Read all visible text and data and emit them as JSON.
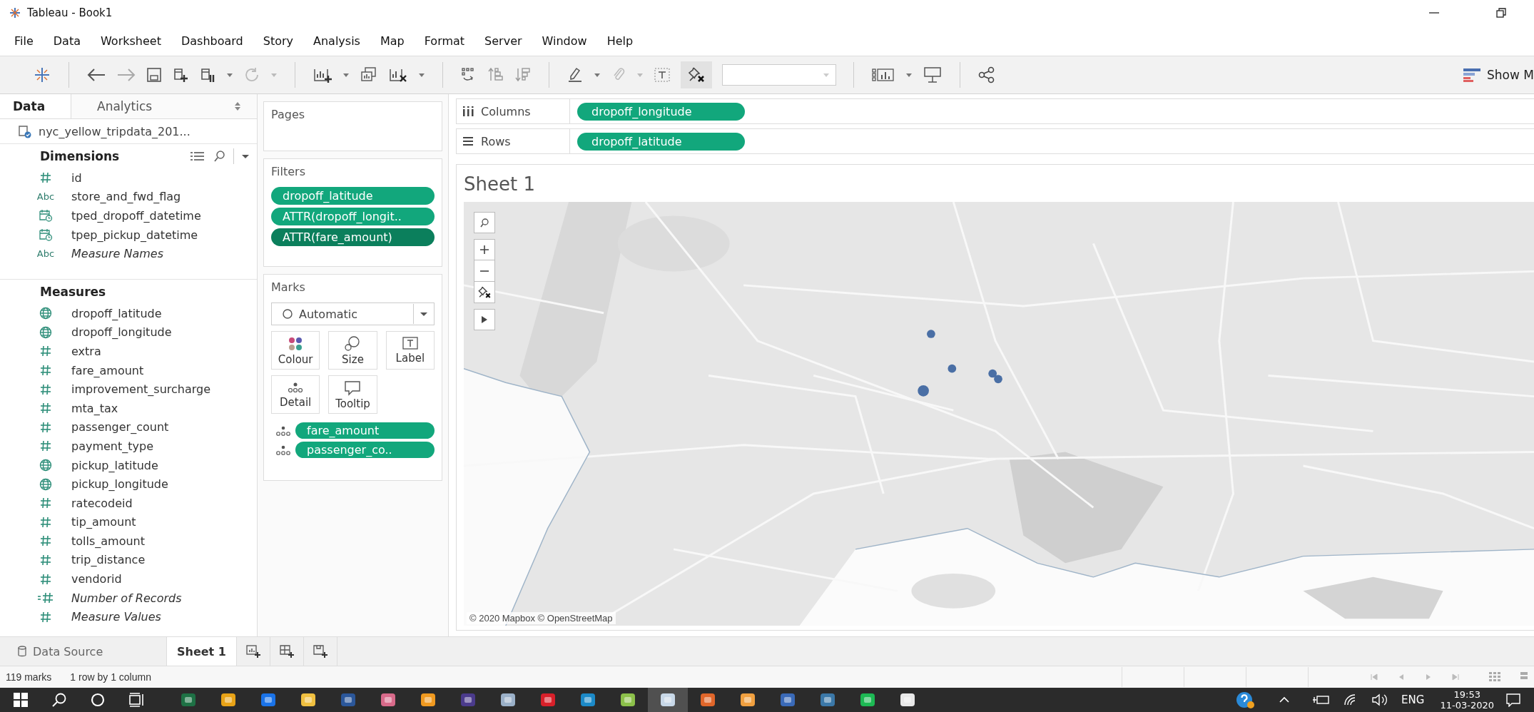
{
  "window": {
    "title": "Tableau - Book1"
  },
  "menu": [
    "File",
    "Data",
    "Worksheet",
    "Dashboard",
    "Story",
    "Analysis",
    "Map",
    "Format",
    "Server",
    "Window",
    "Help"
  ],
  "toolbar": {
    "show_me": "Show M"
  },
  "data_pane": {
    "tabs": [
      {
        "label": "Data",
        "selected": true
      },
      {
        "label": "Analytics",
        "selected": false
      }
    ],
    "data_source": "nyc_yellow_tripdata_201...",
    "dimensions": {
      "title": "Dimensions",
      "items": [
        {
          "kind": "number",
          "name": "id",
          "italic": false
        },
        {
          "kind": "string",
          "badge": "Abc",
          "name": "store_and_fwd_flag",
          "italic": false
        },
        {
          "kind": "date",
          "name": "tped_dropoff_datetime",
          "italic": false
        },
        {
          "kind": "date",
          "name": "tpep_pickup_datetime",
          "italic": false
        },
        {
          "kind": "string",
          "badge": "Abc",
          "name": "Measure Names",
          "italic": true
        }
      ]
    },
    "measures": {
      "title": "Measures",
      "items": [
        {
          "kind": "geo",
          "name": "dropoff_latitude",
          "italic": false
        },
        {
          "kind": "geo",
          "name": "dropoff_longitude",
          "italic": false
        },
        {
          "kind": "number",
          "name": "extra",
          "italic": false
        },
        {
          "kind": "number",
          "name": "fare_amount",
          "italic": false
        },
        {
          "kind": "number",
          "name": "improvement_surcharge",
          "italic": false
        },
        {
          "kind": "number",
          "name": "mta_tax",
          "italic": false
        },
        {
          "kind": "number",
          "name": "passenger_count",
          "italic": false
        },
        {
          "kind": "number",
          "name": "payment_type",
          "italic": false
        },
        {
          "kind": "geo",
          "name": "pickup_latitude",
          "italic": false
        },
        {
          "kind": "geo",
          "name": "pickup_longitude",
          "italic": false
        },
        {
          "kind": "number",
          "name": "ratecodeid",
          "italic": false
        },
        {
          "kind": "number",
          "name": "tip_amount",
          "italic": false
        },
        {
          "kind": "number",
          "name": "tolls_amount",
          "italic": false
        },
        {
          "kind": "number",
          "name": "trip_distance",
          "italic": false
        },
        {
          "kind": "number",
          "name": "vendorid",
          "italic": false
        },
        {
          "kind": "calc",
          "name": "Number of Records",
          "italic": true
        },
        {
          "kind": "number",
          "name": "Measure Values",
          "italic": true
        }
      ]
    }
  },
  "pages": {
    "title": "Pages"
  },
  "filters": {
    "title": "Filters",
    "pills": [
      {
        "label": "dropoff_latitude",
        "selected": false
      },
      {
        "label": "ATTR(dropoff_longit..",
        "selected": false
      },
      {
        "label": "ATTR(fare_amount)",
        "selected": true
      }
    ]
  },
  "marks": {
    "title": "Marks",
    "mark_type": "Automatic",
    "cards": [
      {
        "kind": "colour",
        "label": "Colour"
      },
      {
        "kind": "size",
        "label": "Size"
      },
      {
        "kind": "label",
        "label": "Label"
      },
      {
        "kind": "detail",
        "label": "Detail"
      },
      {
        "kind": "tooltip",
        "label": "Tooltip"
      }
    ],
    "pills": [
      {
        "label": "fare_amount"
      },
      {
        "label": "passenger_co.."
      }
    ]
  },
  "shelves": [
    {
      "kind": "columns",
      "label": "Columns",
      "pill": "dropoff_longitude"
    },
    {
      "kind": "rows",
      "label": "Rows",
      "pill": "dropoff_latitude"
    }
  ],
  "sheet": {
    "title": "Sheet 1",
    "attribution": "© 2020 Mapbox © OpenStreetMap"
  },
  "sheet_tabs": [
    {
      "kind": "datasource",
      "label": "Data Source",
      "selected": false
    },
    {
      "kind": "sheet",
      "label": "Sheet 1",
      "selected": true
    }
  ],
  "status_bar": [
    "119 marks",
    "1 row by 1 column"
  ],
  "taskbar": {
    "language": "ENG",
    "time": "19:53",
    "date": "11-03-2020"
  }
}
